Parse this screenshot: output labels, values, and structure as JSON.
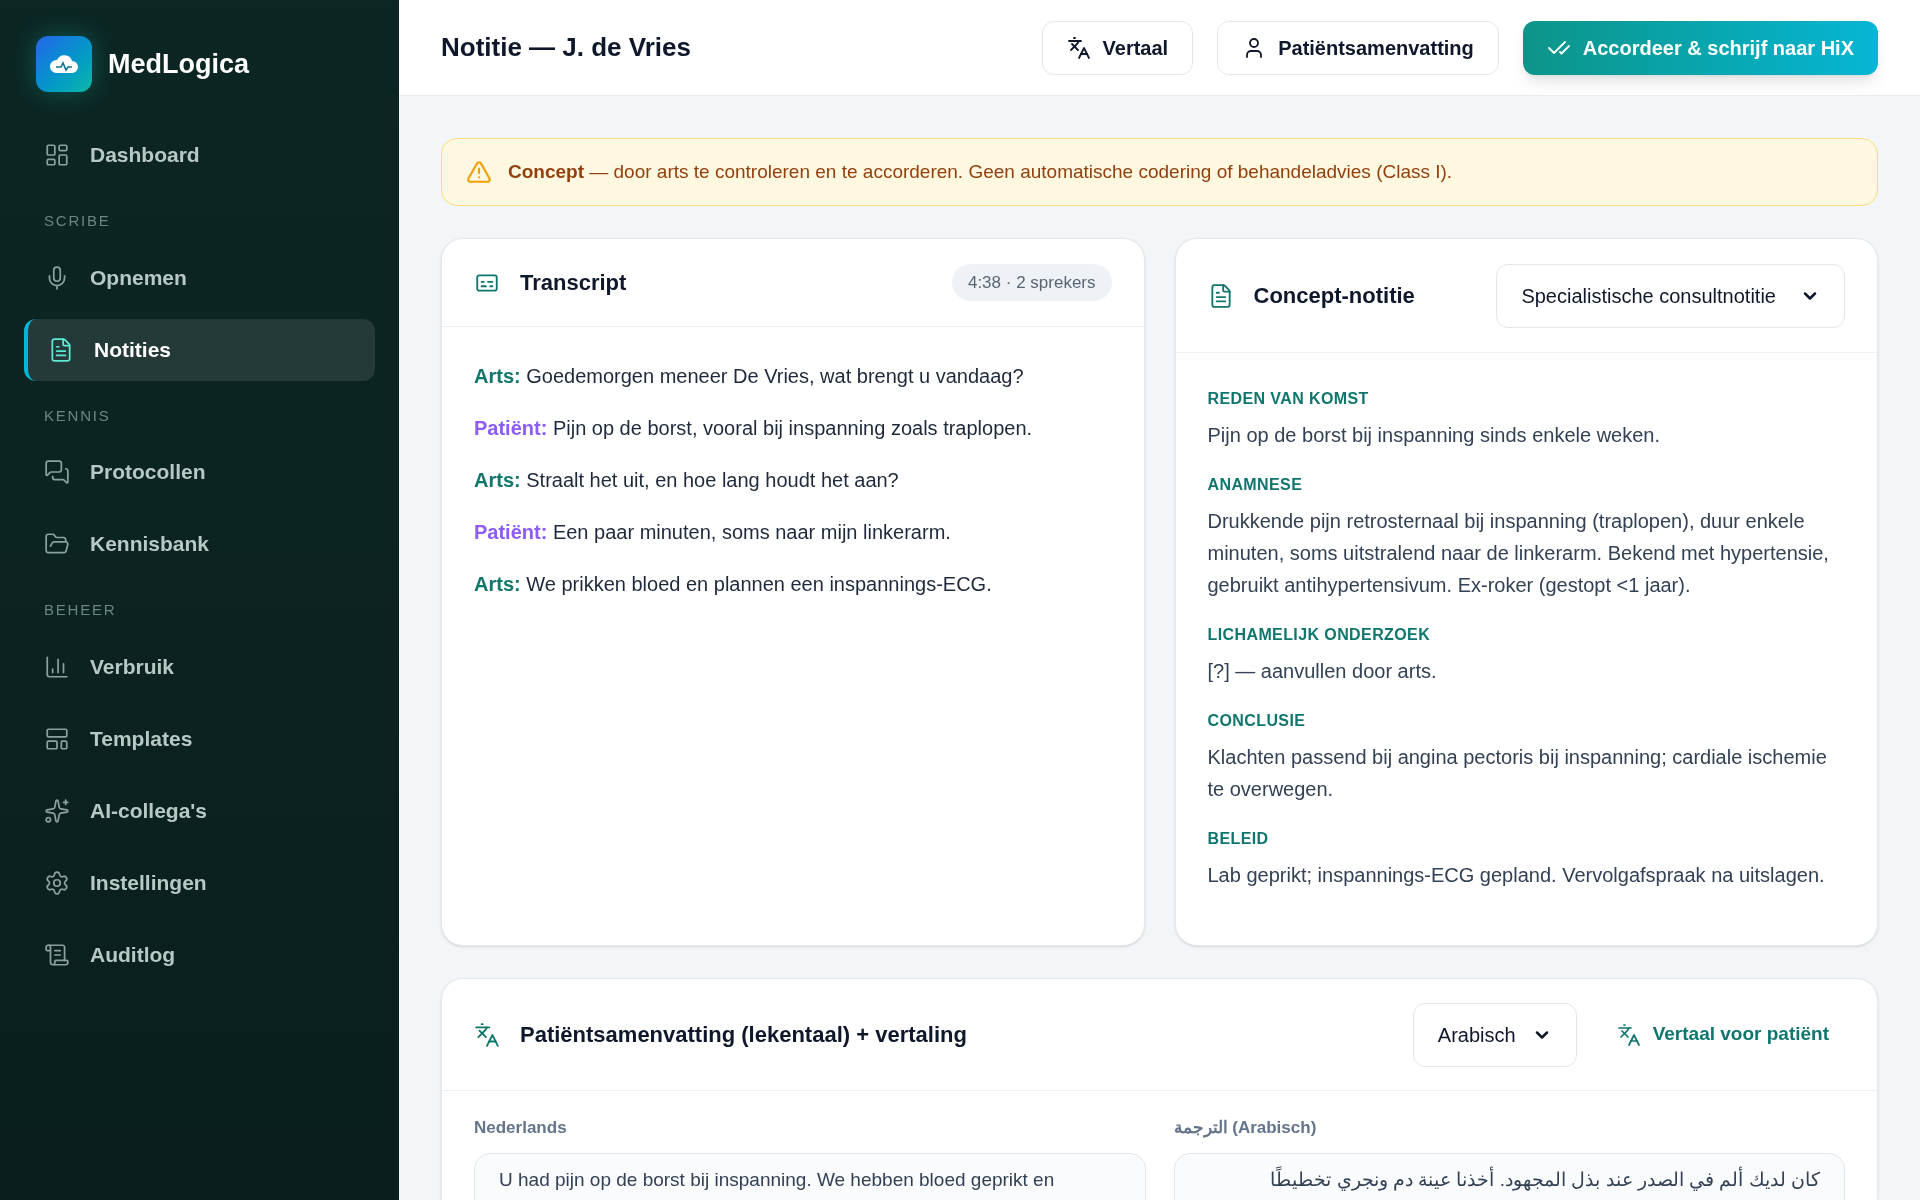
{
  "app": {
    "name": "MedLogica"
  },
  "sidebar": {
    "groups": [
      {
        "items": [
          {
            "label": "Dashboard",
            "selected": false
          }
        ]
      },
      {
        "heading": "SCRIBE",
        "items": [
          {
            "label": "Opnemen",
            "selected": false
          },
          {
            "label": "Notities",
            "selected": true
          }
        ]
      },
      {
        "heading": "KENNIS",
        "items": [
          {
            "label": "Protocollen",
            "selected": false
          },
          {
            "label": "Kennisbank",
            "selected": false
          }
        ]
      },
      {
        "heading": "BEHEER",
        "items": [
          {
            "label": "Verbruik",
            "selected": false
          },
          {
            "label": "Templates",
            "selected": false
          },
          {
            "label": "AI-collega's",
            "selected": false
          },
          {
            "label": "Instellingen",
            "selected": false
          },
          {
            "label": "Auditlog",
            "selected": false
          }
        ]
      }
    ]
  },
  "header": {
    "title": "Notitie — J. de Vries",
    "buttons": [
      {
        "label": "Vertaal",
        "kind": "secondary"
      },
      {
        "label": "Patiëntsamenvatting",
        "kind": "secondary"
      },
      {
        "label": "Accordeer & schrijf naar HiX",
        "kind": "primary"
      }
    ]
  },
  "banner": {
    "text": "**Concept** — door arts te controleren en te accorderen. Geen automatische codering of behandeladvies (Class I)."
  },
  "transcript": {
    "title": "Transcript",
    "badge": "4:38 · 2 sprekers",
    "lines": [
      {
        "kind": "arts",
        "speaker": "Arts:",
        "text": "Goedemorgen meneer De Vries, wat brengt u vandaag?"
      },
      {
        "kind": "patient",
        "speaker": "Patiënt:",
        "text": "Pijn op de borst, vooral bij inspanning zoals traplopen."
      },
      {
        "kind": "arts",
        "speaker": "Arts:",
        "text": "Straalt het uit, en hoe lang houdt het aan?"
      },
      {
        "kind": "patient",
        "speaker": "Patiënt:",
        "text": "Een paar minuten, soms naar mijn linkerarm."
      },
      {
        "kind": "arts",
        "speaker": "Arts:",
        "text": "We prikken bloed en plannen een inspannings-ECG."
      }
    ]
  },
  "note": {
    "title": "Concept-notitie",
    "template": "Specialistische consultnotitie",
    "sections": [
      {
        "heading": "REDEN VAN KOMST",
        "text": "Pijn op de borst bij inspanning sinds enkele weken."
      },
      {
        "heading": "ANAMNESE",
        "text": "Drukkende pijn retrosternaal bij inspanning (traplopen), duur enkele minuten, soms uitstralend naar de linkerarm. Bekend met hypertensie, gebruikt antihypertensivum. Ex-roker (gestopt <1 jaar)."
      },
      {
        "heading": "LICHAMELIJK ONDERZOEK",
        "text": "[?] — aanvullen door arts."
      },
      {
        "heading": "CONCLUSIE",
        "text": "Klachten passend bij angina pectoris bij inspanning; cardiale ischemie te overwegen."
      },
      {
        "heading": "BELEID",
        "text": "Lab geprikt; inspannings-ECG gepland. Vervolgafspraak na uitslagen."
      }
    ]
  },
  "summary": {
    "title": "Patiëntsamenvatting (lekentaal) + vertaling",
    "language": "Arabisch",
    "action": "Vertaal voor patiënt",
    "columns": [
      {
        "label": "Nederlands",
        "kind": "ltr",
        "text": "U had pijn op de borst bij inspanning. We hebben bloed geprikt en"
      },
      {
        "label": "الترجمة (Arabisch)",
        "kind": "rtl",
        "text": "كان لديك ألم في الصدر عند بذل المجهود. أخذنا عينة دم ونجري تخطيطًا"
      }
    ]
  }
}
